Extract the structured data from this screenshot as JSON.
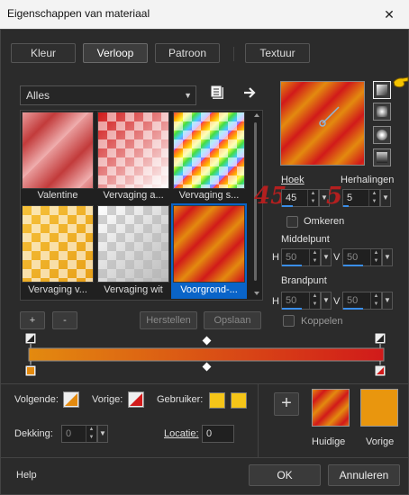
{
  "window": {
    "title": "Eigenschappen van materiaal",
    "close_glyph": "✕"
  },
  "tabs": [
    {
      "label": "Kleur",
      "active": false
    },
    {
      "label": "Verloop",
      "active": true
    },
    {
      "label": "Patroon",
      "active": false
    },
    {
      "label": "Textuur",
      "active": false
    }
  ],
  "library": {
    "category": "Alles",
    "thumbnails": [
      {
        "label": "Valentine",
        "selected": false
      },
      {
        "label": "Vervaging a...",
        "selected": false
      },
      {
        "label": "Vervaging s...",
        "selected": false
      },
      {
        "label": "Vervaging v...",
        "selected": false
      },
      {
        "label": "Vervaging wit",
        "selected": false
      },
      {
        "label": "Voorgrond-...",
        "selected": true
      }
    ],
    "add_label": "+",
    "remove_label": "-",
    "reset_label": "Herstellen",
    "save_label": "Opslaan"
  },
  "gradient": {
    "angle_label": "Hoek",
    "angle_value": "45",
    "repeats_label": "Herhalingen",
    "repeats_value": "5",
    "invert_label": "Omkeren",
    "center_label": "Middelpunt",
    "center_h": "50",
    "center_v": "50",
    "focus_label": "Brandpunt",
    "focus_h": "50",
    "focus_v": "50",
    "link_label": "Koppelen",
    "h_label": "H",
    "v_label": "V",
    "annotation_angle": "45",
    "annotation_repeats": "5",
    "start_color": "#e38a0f",
    "end_color": "#d11a1a"
  },
  "stops": {
    "next_label": "Volgende:",
    "prev_label": "Vorige:",
    "user_label": "Gebruiker:",
    "opacity_label": "Dekking:",
    "opacity_value": "0",
    "location_label": "Locatie:",
    "location_value": "0"
  },
  "preview": {
    "current_label": "Huidige",
    "previous_label": "Vorige",
    "add_glyph": "+",
    "previous_color": "#e9960e",
    "user_color": "#f5c518"
  },
  "footer": {
    "help_label": "Help",
    "ok_label": "OK",
    "cancel_label": "Annuleren"
  }
}
